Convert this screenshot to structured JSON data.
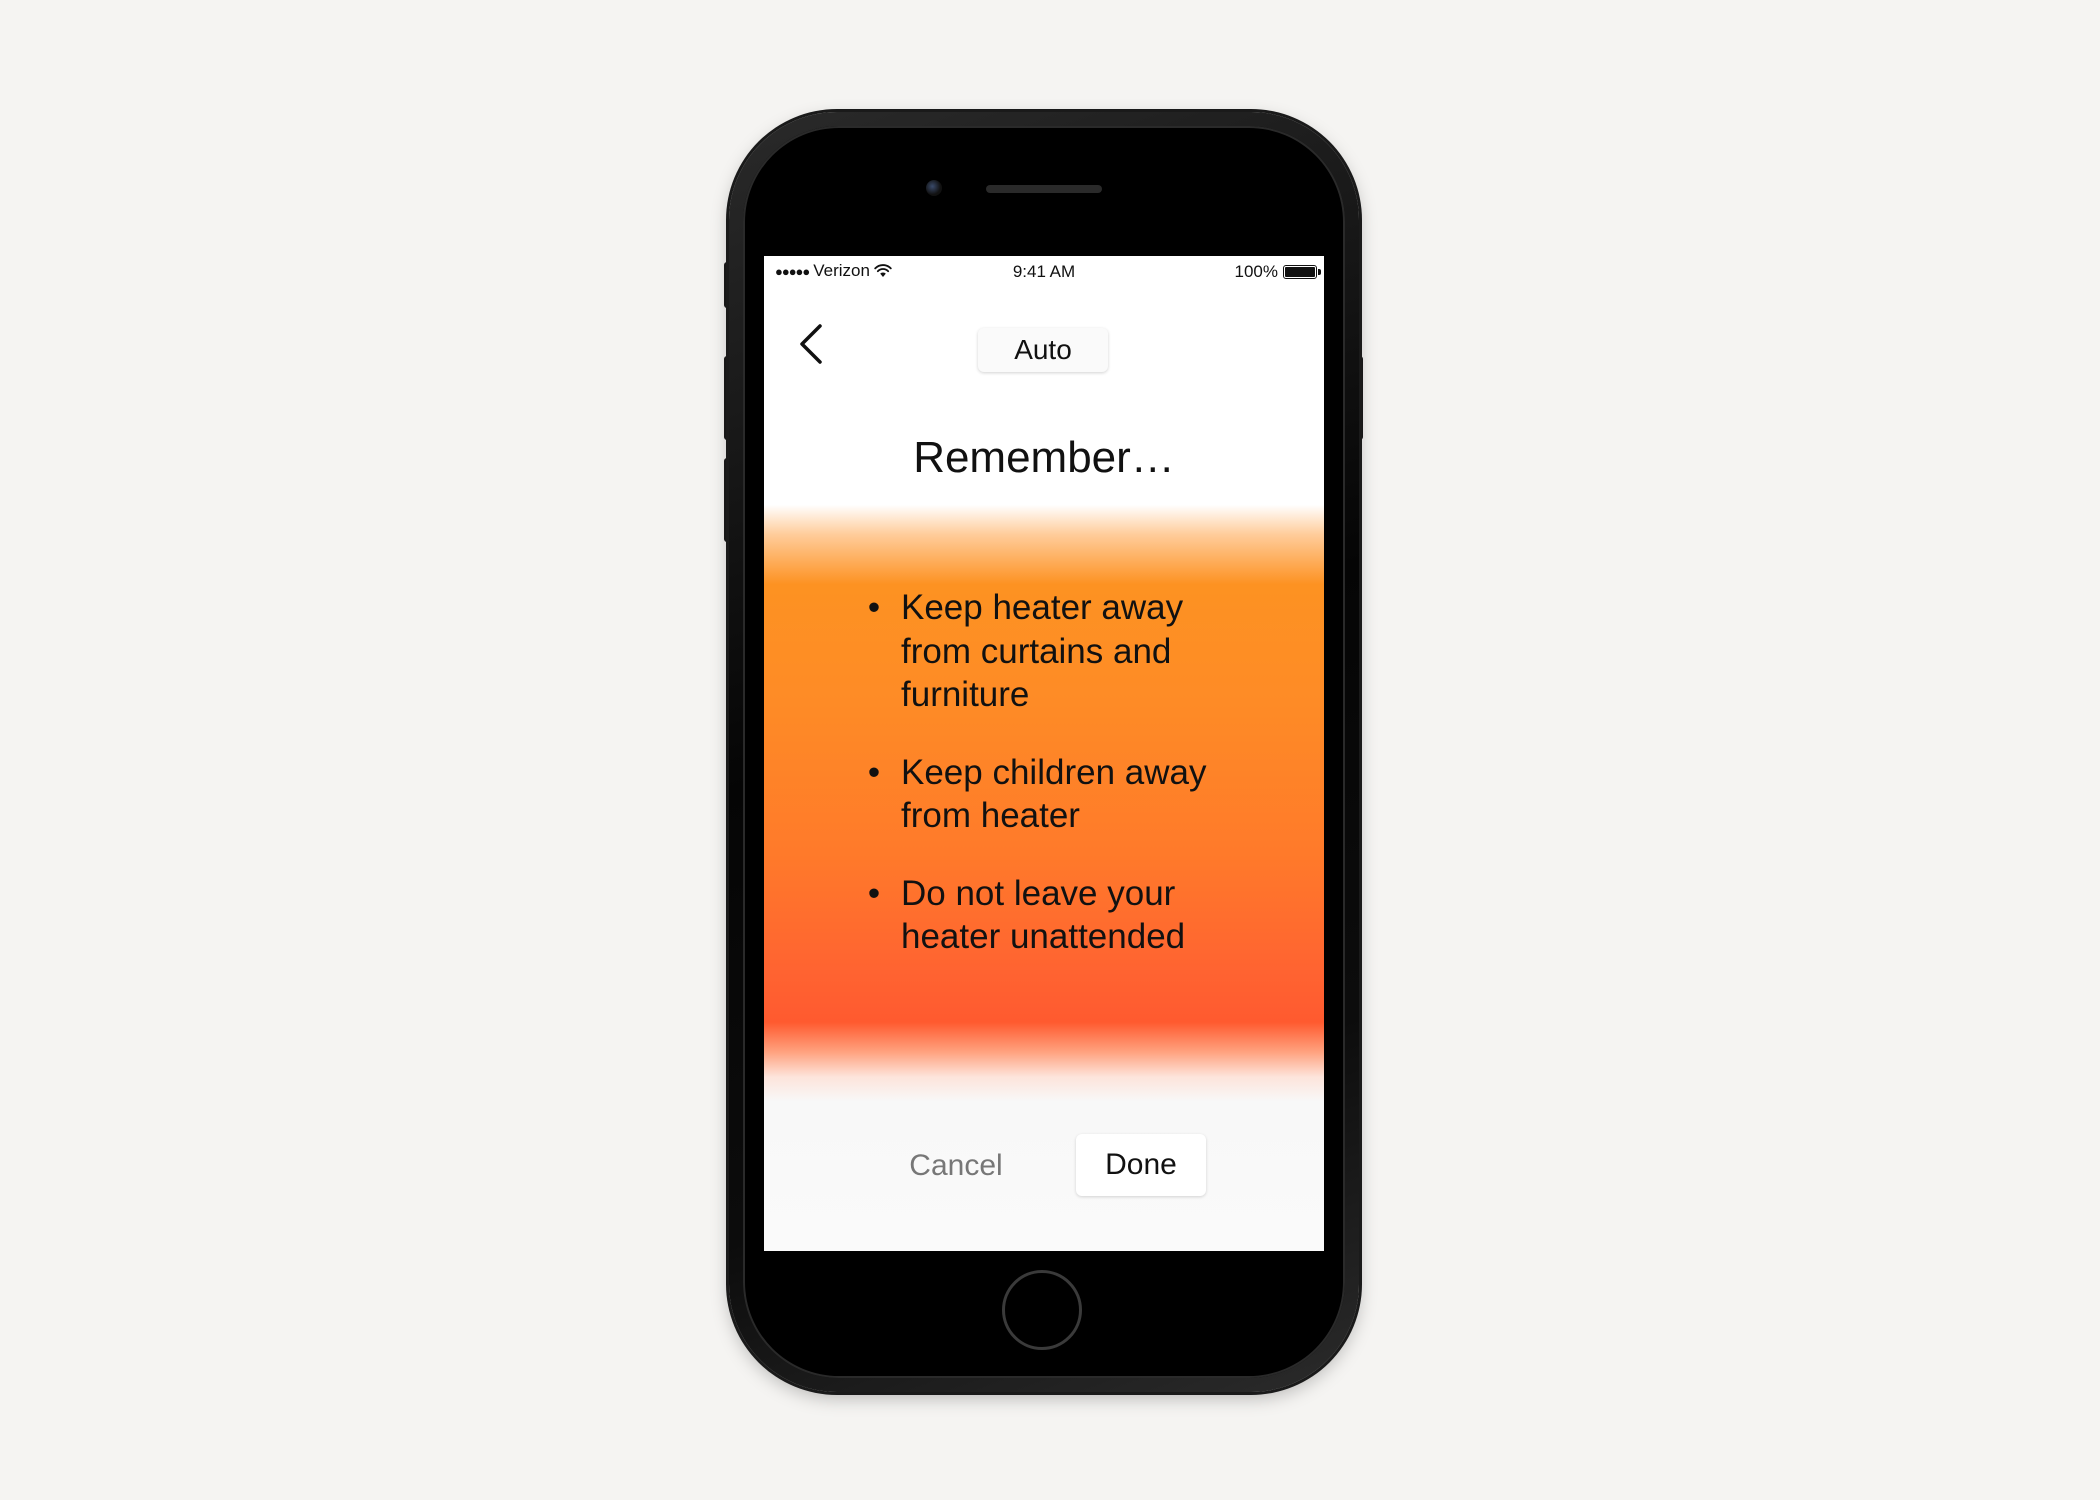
{
  "status_bar": {
    "signal": "●●●●●",
    "carrier": "Verizon",
    "time": "9:41 AM",
    "battery_percent": "100%",
    "battery_level": 1.0
  },
  "header": {
    "back_icon": "chevron-left-icon",
    "mode_label": "Auto"
  },
  "title": "Remember…",
  "tips": [
    {
      "text": "Keep heater away from curtains and furniture"
    },
    {
      "text": "Keep children away from heater"
    },
    {
      "text": "Do not leave your heater unattended"
    }
  ],
  "bullet": "•",
  "footer": {
    "cancel_label": "Cancel",
    "done_label": "Done"
  },
  "colors": {
    "background": "#f5f4f2",
    "gradient_top": "#fd9222",
    "gradient_bottom": "#ff5a2f",
    "text": "#111111",
    "muted_text": "#777777"
  }
}
